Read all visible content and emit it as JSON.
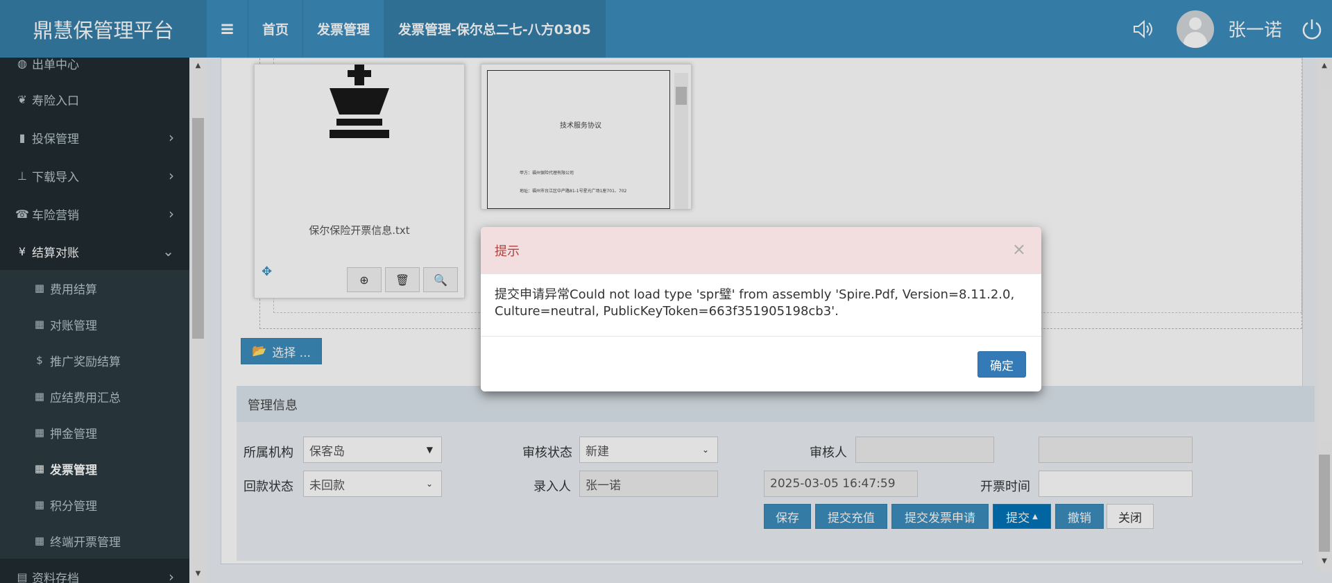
{
  "header": {
    "logo": "鼎慧保管理平台",
    "nav": [
      {
        "label": "首页"
      },
      {
        "label": "发票管理"
      },
      {
        "label": "发票管理-保尔总二七-八方0305"
      }
    ],
    "username": "张一诺"
  },
  "sidebar": {
    "items": [
      {
        "label": "出单中心"
      },
      {
        "label": "寿险入口"
      },
      {
        "label": "投保管理"
      },
      {
        "label": "下载导入"
      },
      {
        "label": "车险营销"
      },
      {
        "label": "结算对账"
      },
      {
        "label": "资料存档"
      }
    ],
    "sub_items": [
      {
        "label": "费用结算"
      },
      {
        "label": "对账管理"
      },
      {
        "label": "推广奖励结算"
      },
      {
        "label": "应结费用汇总"
      },
      {
        "label": "押金管理"
      },
      {
        "label": "发票管理"
      },
      {
        "label": "积分管理"
      },
      {
        "label": "终端开票管理"
      }
    ]
  },
  "files": {
    "txt_name": "保尔保险开票信息.txt",
    "pdf_title": "技术服务协议",
    "pdf_line1": "甲方：福州保险代理有限公司",
    "pdf_line2": "地址：福州市台江区中产路81-1号星光广场1座701、702"
  },
  "upload": {
    "select_label": "选择 ..."
  },
  "management": {
    "title": "管理信息",
    "org_label": "所属机构",
    "org_value": "保客岛",
    "review_status_label": "审核状态",
    "review_status_value": "新建",
    "reviewer_label": "审核人",
    "reviewer_value": "",
    "refund_status_label": "回款状态",
    "refund_status_value": "未回款",
    "entry_label": "录入人",
    "entry_value": "张一诺",
    "entry_time_value": "2025-03-05 16:47:59",
    "invoice_time_label": "开票时间",
    "invoice_time_value": ""
  },
  "buttons": {
    "save": "保存",
    "submit_recharge": "提交充值",
    "submit_invoice": "提交发票申请",
    "submit": "提交",
    "revoke": "撤销",
    "close": "关闭"
  },
  "modal": {
    "title": "提示",
    "message": "提交申请异常Could not load type 'spr璧' from assembly 'Spire.Pdf, Version=8.11.2.0, Culture=neutral, PublicKeyToken=663f351905198cb3'.",
    "ok": "确定"
  },
  "colors": {
    "header": "#3c8dbc",
    "sidebar": "#222d32",
    "primary": "#3c8dbc",
    "modal_header": "#f2dede",
    "modal_title": "#a94442"
  }
}
